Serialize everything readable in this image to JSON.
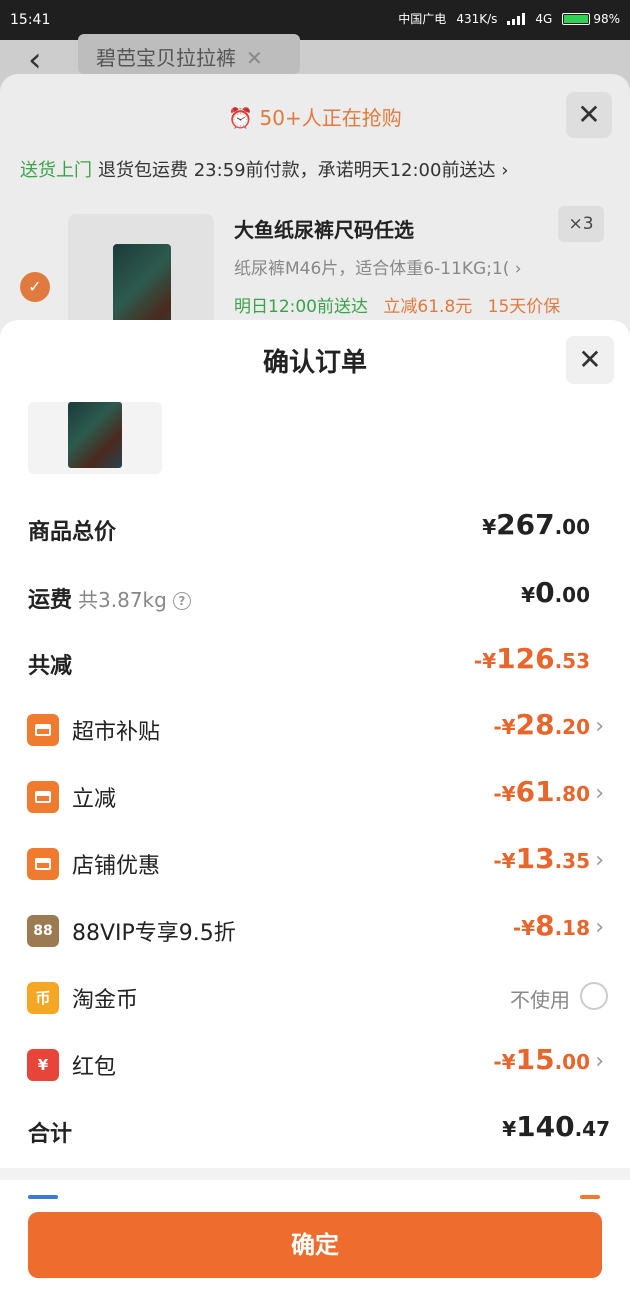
{
  "status_bar": {
    "time": "15:41",
    "carrier": "中国广电",
    "speed": "431K/s",
    "network": "4G",
    "battery": "98%"
  },
  "background": {
    "search_chip": "碧芭宝贝拉拉裤",
    "promo": "50+人正在抢购",
    "delivery_tag": "送货上门",
    "delivery_text": "退货包运费 23:59前付款，承诺明天12:00前送达",
    "product_title": "大鱼纸尿裤尺码任选",
    "product_spec": "纸尿裤M46片，适合体重6-11KG;1(",
    "quantity": "×3",
    "tag_delivery": "明日12:00前送达",
    "tag_discount": "立减61.8元",
    "tag_protect": "15天价保"
  },
  "sheet": {
    "title": "确认订单",
    "rows": {
      "total_goods": {
        "label": "商品总价",
        "currency": "¥",
        "int": "267",
        "dec": ".00"
      },
      "shipping": {
        "label": "运费",
        "sub": "共3.87kg",
        "currency": "¥",
        "int": "0",
        "dec": ".00"
      },
      "total_discount": {
        "label": "共减",
        "currency": "-¥",
        "int": "126",
        "dec": ".53"
      },
      "supermarket": {
        "label": "超市补贴",
        "currency": "-¥",
        "int": "28",
        "dec": ".20"
      },
      "instant": {
        "label": "立减",
        "currency": "-¥",
        "int": "61",
        "dec": ".80"
      },
      "store": {
        "label": "店铺优惠",
        "currency": "-¥",
        "int": "13",
        "dec": ".35"
      },
      "vip": {
        "label": "88VIP专享9.5折",
        "icon_text": "88",
        "currency": "-¥",
        "int": "8",
        "dec": ".18"
      },
      "coins": {
        "label": "淘金币",
        "icon_text": "币",
        "value": "不使用"
      },
      "redpacket": {
        "label": "红包",
        "icon_text": "¥",
        "currency": "-¥",
        "int": "15",
        "dec": ".00"
      },
      "sum": {
        "label": "合计",
        "currency": "¥",
        "int": "140",
        "dec": ".47"
      }
    },
    "confirm_label": "确定"
  },
  "icons": {
    "back": "back-arrow-icon",
    "close": "close-icon",
    "chevron": "chevron-right-icon",
    "help": "help-icon",
    "store": "store-icon",
    "coin": "coin-icon",
    "redpacket": "red-packet-icon"
  },
  "colors": {
    "accent": "#ee6d2e",
    "discount": "#e8652c",
    "green": "#3aa34a"
  }
}
